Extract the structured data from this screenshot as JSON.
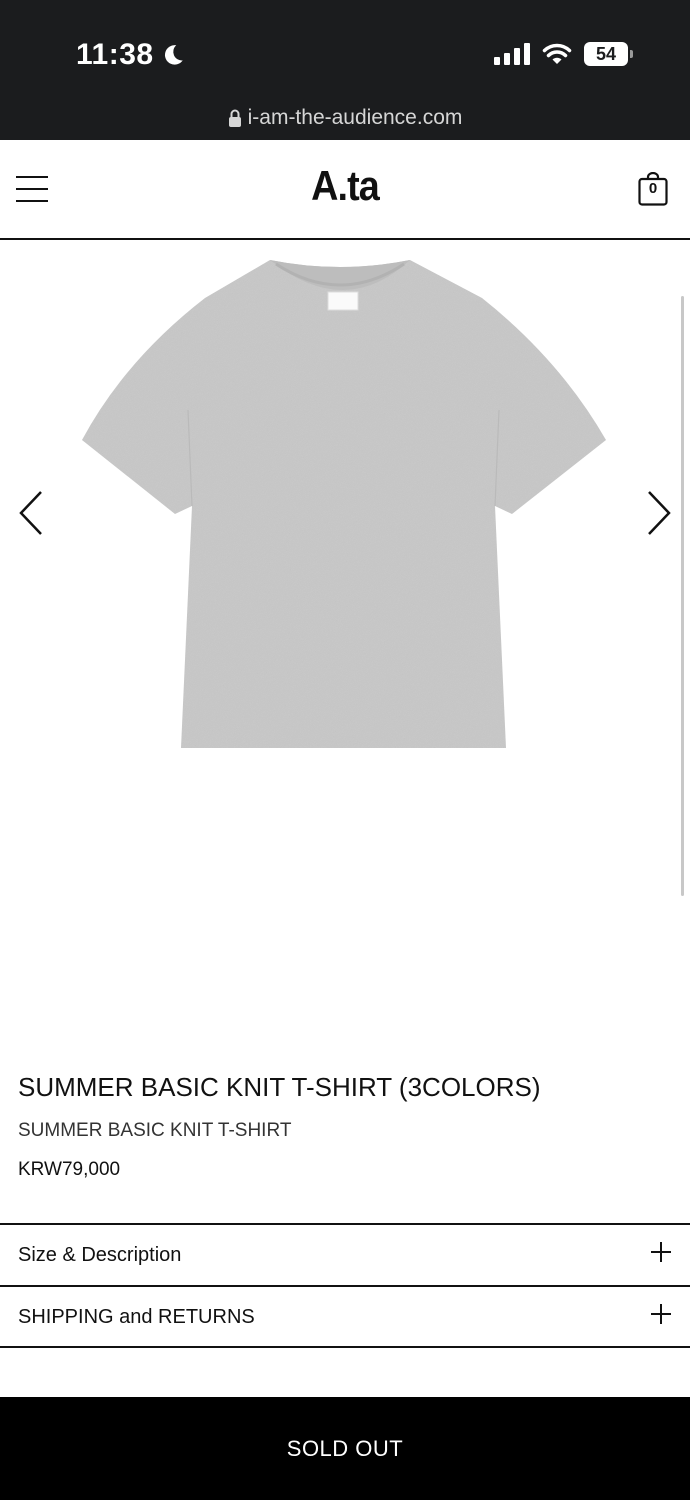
{
  "status_bar": {
    "time": "11:38",
    "battery": "54",
    "url": "i-am-the-audience.com"
  },
  "header": {
    "logo": "A.ta",
    "cart_count": "0"
  },
  "product": {
    "title": "SUMMER BASIC KNIT T-SHIRT (3COLORS)",
    "subtitle": "SUMMER BASIC KNIT T-SHIRT",
    "price": "KRW79,000",
    "image_color": "#c8c8c8"
  },
  "accordions": [
    {
      "label": "Size & Description"
    },
    {
      "label": "SHIPPING and RETURNS"
    }
  ],
  "cta": {
    "label": "SOLD OUT"
  },
  "icons": [
    "moon-icon",
    "signal-icon",
    "wifi-icon",
    "battery-icon",
    "lock-icon",
    "menu-icon",
    "cart-icon",
    "chevron-left-icon",
    "chevron-right-icon",
    "plus-icon"
  ]
}
